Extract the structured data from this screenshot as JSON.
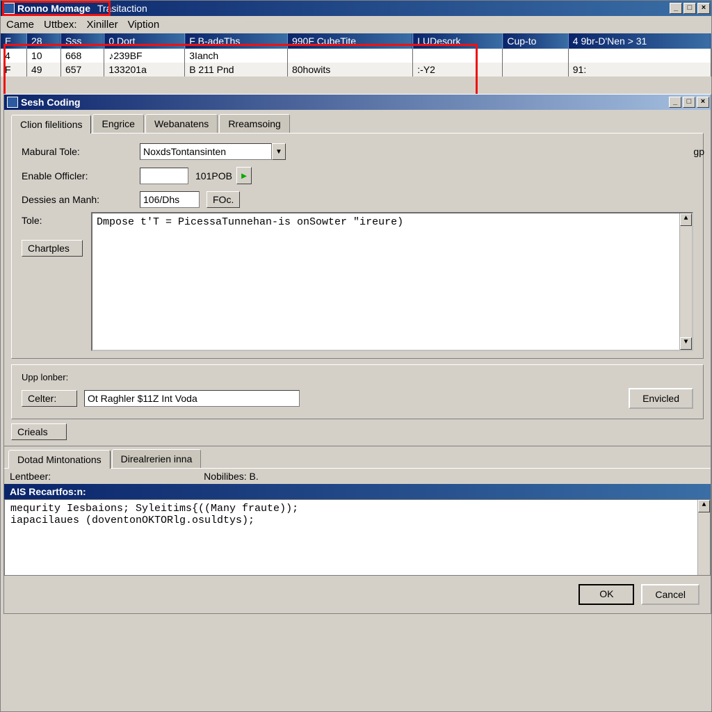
{
  "main_window": {
    "title_a": "Ronno Momage",
    "title_b": "Trasitaction",
    "menus": [
      "Came",
      "Uttbex:",
      "Xiniller",
      "Viption"
    ]
  },
  "table": {
    "headers": [
      "E",
      "28",
      "Sss",
      "0 Dort",
      "F B-adeThs",
      "990F CubeTite",
      "LUDesork",
      "Cup-to",
      "4 9br-D'Nen > 31"
    ],
    "rows": [
      [
        "4",
        "10",
        "668",
        "♪239BF",
        "3Ianch",
        "",
        "",
        "",
        ""
      ],
      [
        "F",
        "49",
        "657",
        "133201a",
        "B 211 Pnd",
        "80howits",
        ":-Y2",
        "",
        "91:"
      ]
    ]
  },
  "child_window": {
    "title": "Sesh Coding"
  },
  "tabs_top": {
    "items": [
      "Clion filelitions",
      "Engrice",
      "Webanatens",
      "Rreamsoing"
    ],
    "active": 0
  },
  "form": {
    "label_mabural": "Mabural Tole:",
    "combo_value": "NoxdsTontansinten",
    "label_enable": "Enable Officler:",
    "enable_value": "",
    "enable_code": "101POB",
    "label_dessies": "Dessies an Manh:",
    "dessies_value": "106/Dhs",
    "dessies_btn": "FOc.",
    "label_tole": "Tole:",
    "tole_text": "Dmpose t'T = PicessaTunnehan-is onSowter \"ireure)",
    "chartples_btn": "Chartples"
  },
  "right_hint": "gp",
  "upp": {
    "label": "Upp lonber:",
    "celter_btn": "Celter:",
    "celter_value": "Ot Raghler $11Z Int Voda",
    "envicled_btn": "Envicled"
  },
  "crieals_btn": "Crieals",
  "tabs_bottom": {
    "items": [
      "Dotad Mintonations",
      "Direalrerien inna"
    ],
    "active": 0
  },
  "status": {
    "lentbeer": "Lentbeer:",
    "nobim": "Nobilibes: B."
  },
  "code": {
    "head": "AIS  Recartfos:n:",
    "line1": "mequrity Iesbaions; Syleitims{((Many fraute));",
    "line2": "iapacilaues (doventonOKTORlg.osuldtys);"
  },
  "dlg": {
    "ok": "OK",
    "cancel": "Cancel"
  }
}
